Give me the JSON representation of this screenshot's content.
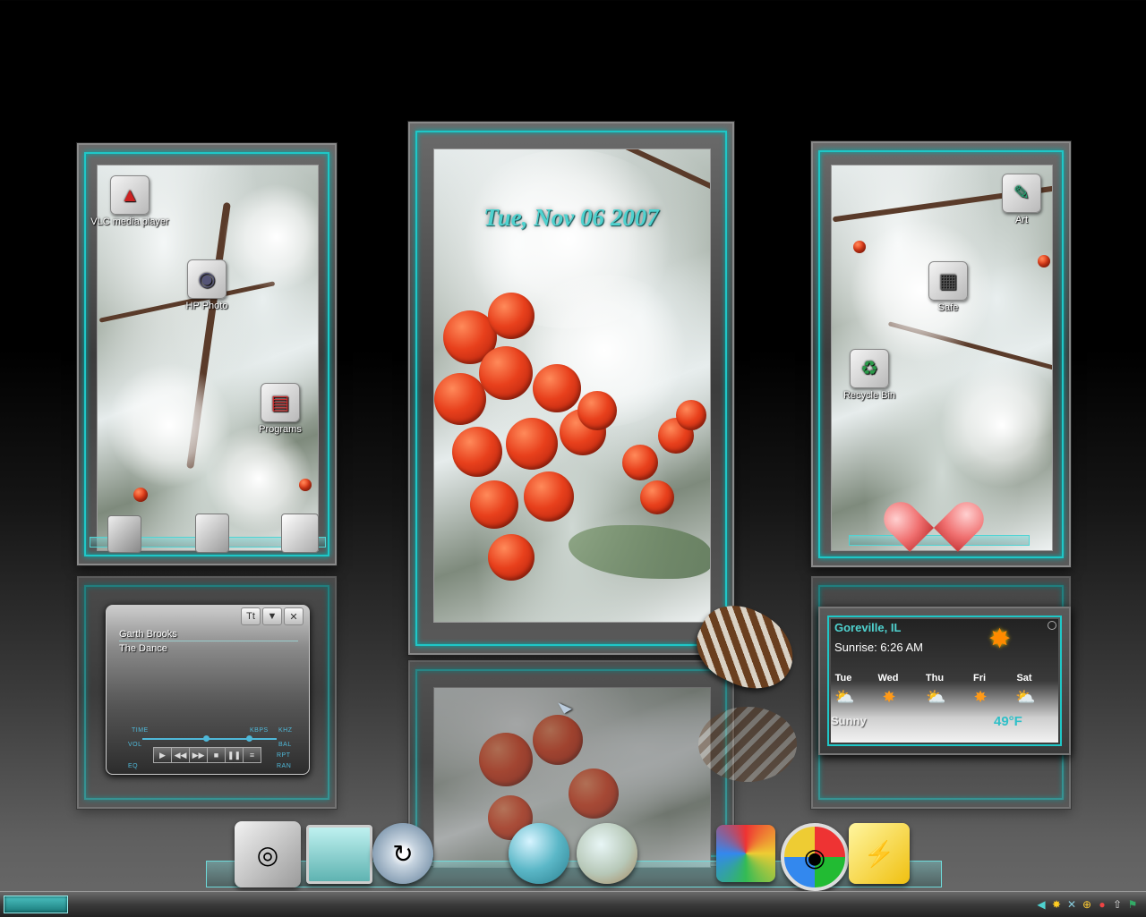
{
  "date_display": "Tue, Nov 06 2007",
  "desktop_icons": {
    "vlc": "VLC media player",
    "hp_photo": "HP Photo",
    "programs": "Programs",
    "art": "Art",
    "safe": "Safe",
    "recycle_bin": "Recycle Bin"
  },
  "media_player": {
    "artist": "Garth Brooks",
    "track": "The Dance",
    "labels": {
      "time": "TIME",
      "kbps": "KBPS",
      "khz": "KHZ",
      "vol": "VOL",
      "bal": "BAL",
      "rpt": "RPT",
      "ran": "RAN",
      "eq": "EQ"
    },
    "buttons": {
      "title": "Tt",
      "minimize": "▼",
      "close": "✕"
    }
  },
  "weather": {
    "location": "Goreville, IL",
    "sunrise": "Sunrise: 6:26 AM",
    "condition": "Sunny",
    "temperature": "49°F",
    "days": [
      "Tue",
      "Wed",
      "Thu",
      "Fri",
      "Sat"
    ]
  },
  "colors": {
    "accent": "#1fc7c7",
    "date_text": "#4fd2cf",
    "temp_text": "#2fc0c8"
  },
  "icons": [
    "vlc-icon",
    "camera-icon",
    "programs-icon",
    "art-icon",
    "safe-icon",
    "recycle-bin-icon",
    "heart-clock-icon",
    "pinecone-icon",
    "sun-icon",
    "cloud-sun-icon"
  ]
}
